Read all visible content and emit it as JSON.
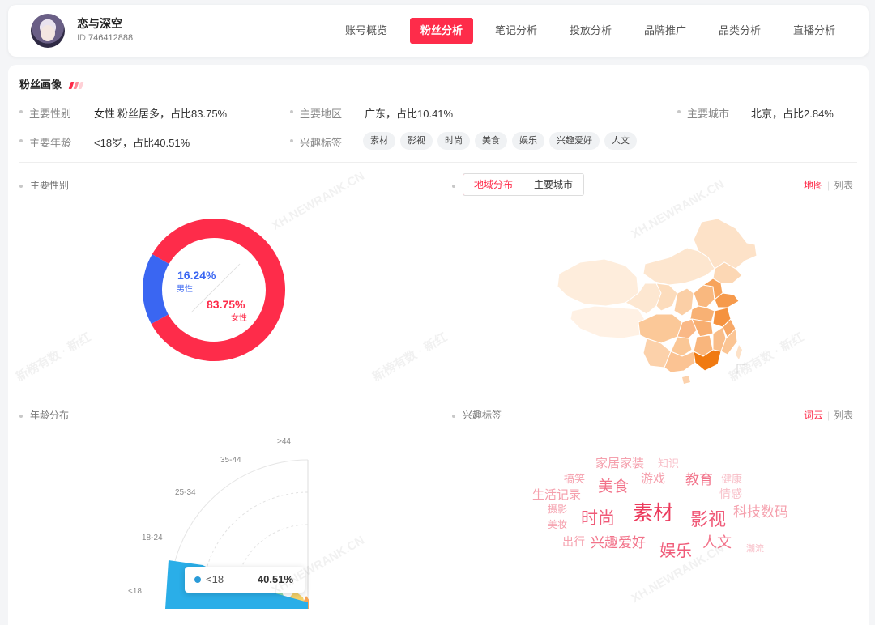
{
  "header": {
    "user_name": "恋与深空",
    "id_label": "ID",
    "id_value": "746412888",
    "tabs": [
      {
        "label": "账号概览",
        "active": false
      },
      {
        "label": "粉丝分析",
        "active": true
      },
      {
        "label": "笔记分析",
        "active": false
      },
      {
        "label": "投放分析",
        "active": false
      },
      {
        "label": "品牌推广",
        "active": false
      },
      {
        "label": "品类分析",
        "active": false
      },
      {
        "label": "直播分析",
        "active": false
      }
    ]
  },
  "profile": {
    "title": "粉丝画像",
    "deco_colors": [
      "#fe2c4a",
      "#ff8a98",
      "#ffd0d6"
    ],
    "gender": {
      "label": "主要性别",
      "value": "女性",
      "note": "粉丝居多，占比83.75%"
    },
    "region": {
      "label": "主要地区",
      "value": "广东，占比10.41%"
    },
    "city": {
      "label": "主要城市",
      "value": "北京，占比2.84%"
    },
    "age": {
      "label": "主要年龄",
      "value": "<18岁，占比40.51%"
    },
    "interest": {
      "label": "兴趣标签",
      "tags": [
        "素材",
        "影视",
        "时尚",
        "美食",
        "娱乐",
        "兴趣爱好",
        "人文"
      ]
    }
  },
  "gender_panel": {
    "label": "主要性别",
    "male": {
      "label": "男性",
      "pct_text": "16.24%",
      "value": 16.24,
      "color": "#3a66f2"
    },
    "female": {
      "label": "女性",
      "pct_text": "83.75%",
      "value": 83.75,
      "color": "#fe2c4a"
    }
  },
  "region_panel": {
    "seg_tabs": [
      {
        "label": "地域分布",
        "active": true
      },
      {
        "label": "主要城市",
        "active": false
      }
    ],
    "view_on": "地图",
    "view_off": "列表"
  },
  "age_panel": {
    "label": "年龄分布",
    "chart_data": {
      "type": "area",
      "categories": [
        "<18",
        "18-24",
        "25-34",
        "35-44",
        ">44"
      ],
      "series_colors": [
        "#2aaee8",
        "#38c2e0",
        "#8fdeb0",
        "#f6d36b",
        "#f6a354"
      ],
      "tooltip": {
        "label": "<18",
        "value": "40.51%"
      }
    }
  },
  "interest_panel": {
    "label": "兴趣标签",
    "view_on": "词云",
    "view_off": "列表",
    "words": [
      {
        "text": "家居家装",
        "size": 15,
        "color": "#f5a0ad"
      },
      {
        "text": "知识",
        "size": 13,
        "color": "#f8bfc8"
      },
      {
        "text": "搞笑",
        "size": 13,
        "color": "#f5a0ad"
      },
      {
        "text": "美食",
        "size": 19,
        "color": "#f2738a"
      },
      {
        "text": "游戏",
        "size": 15,
        "color": "#f5a0ad"
      },
      {
        "text": "教育",
        "size": 17,
        "color": "#f2738a"
      },
      {
        "text": "健康",
        "size": 13,
        "color": "#f8bfc8"
      },
      {
        "text": "生活记录",
        "size": 15,
        "color": "#f5a0ad"
      },
      {
        "text": "情感",
        "size": 14,
        "color": "#f8bfc8"
      },
      {
        "text": "摄影",
        "size": 12,
        "color": "#f5a0ad"
      },
      {
        "text": "时尚",
        "size": 21,
        "color": "#f05a78"
      },
      {
        "text": "素材",
        "size": 25,
        "color": "#ec3a5c"
      },
      {
        "text": "影视",
        "size": 22,
        "color": "#f05a78"
      },
      {
        "text": "科技数码",
        "size": 17,
        "color": "#f5a0ad"
      },
      {
        "text": "美妆",
        "size": 12,
        "color": "#f5a0ad"
      },
      {
        "text": "出行",
        "size": 14,
        "color": "#f5a0ad"
      },
      {
        "text": "兴趣爱好",
        "size": 17,
        "color": "#f2738a"
      },
      {
        "text": "娱乐",
        "size": 20,
        "color": "#f05a78"
      },
      {
        "text": "人文",
        "size": 18,
        "color": "#f2738a"
      },
      {
        "text": "潮流",
        "size": 11,
        "color": "#f8bfc8"
      }
    ]
  },
  "watermarks": [
    "XH.NEWRANK.CN",
    "新榜有数 · 新红"
  ]
}
